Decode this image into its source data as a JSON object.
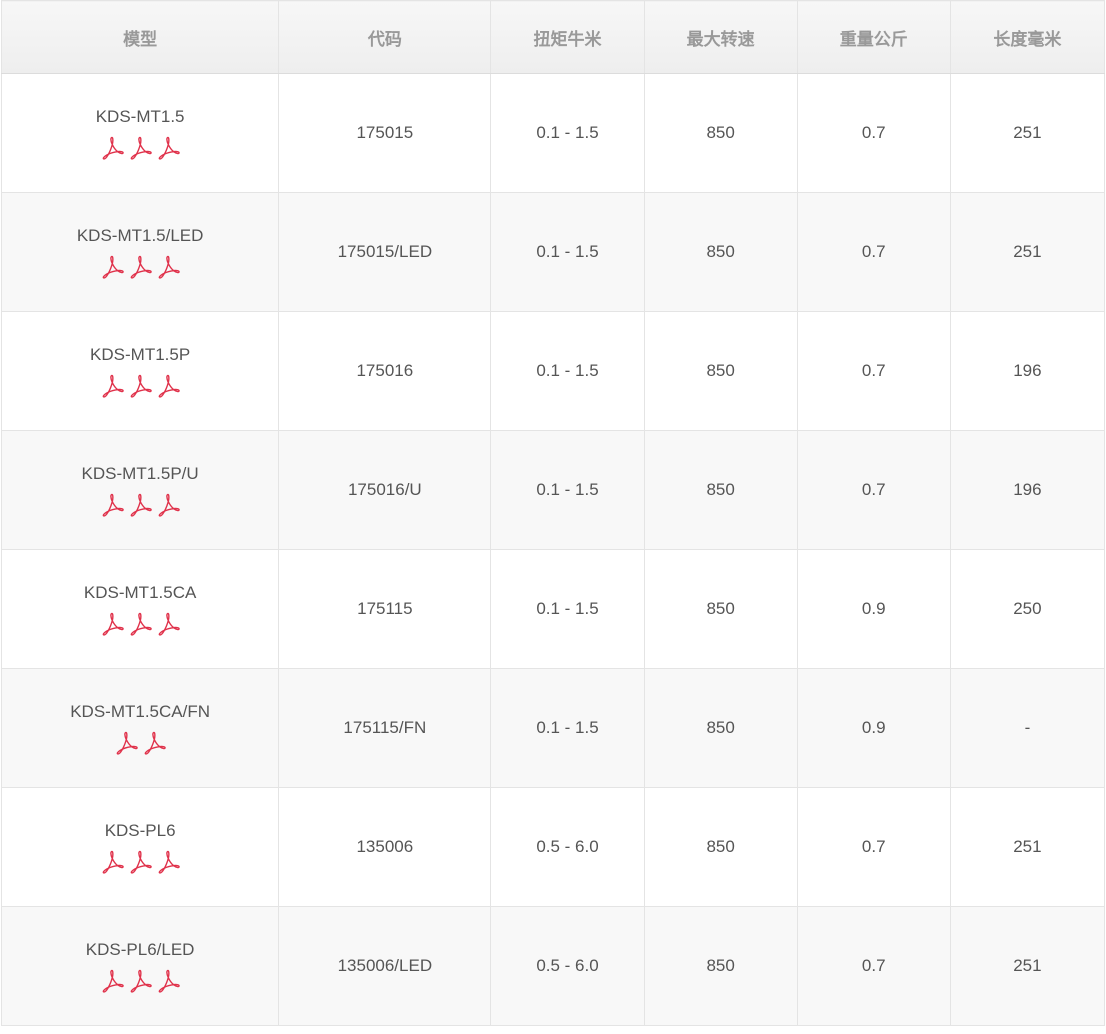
{
  "table": {
    "headers": [
      "模型",
      "代码",
      "扭矩牛米",
      "最大转速",
      "重量公斤",
      "长度毫米"
    ],
    "rows": [
      {
        "model": "KDS-MT1.5",
        "pdf_icons": 3,
        "code": "175015",
        "torque": "0.1 - 1.5",
        "max_speed": "850",
        "weight": "0.7",
        "length": "251"
      },
      {
        "model": "KDS-MT1.5/LED",
        "pdf_icons": 3,
        "code": "175015/LED",
        "torque": "0.1 - 1.5",
        "max_speed": "850",
        "weight": "0.7",
        "length": "251"
      },
      {
        "model": "KDS-MT1.5P",
        "pdf_icons": 3,
        "code": "175016",
        "torque": "0.1 - 1.5",
        "max_speed": "850",
        "weight": "0.7",
        "length": "196"
      },
      {
        "model": "KDS-MT1.5P/U",
        "pdf_icons": 3,
        "code": "175016/U",
        "torque": "0.1 - 1.5",
        "max_speed": "850",
        "weight": "0.7",
        "length": "196"
      },
      {
        "model": "KDS-MT1.5CA",
        "pdf_icons": 3,
        "code": "175115",
        "torque": "0.1 - 1.5",
        "max_speed": "850",
        "weight": "0.9",
        "length": "250"
      },
      {
        "model": "KDS-MT1.5CA/FN",
        "pdf_icons": 2,
        "code": "175115/FN",
        "torque": "0.1 - 1.5",
        "max_speed": "850",
        "weight": "0.9",
        "length": "-"
      },
      {
        "model": "KDS-PL6",
        "pdf_icons": 3,
        "code": "135006",
        "torque": "0.5 - 6.0",
        "max_speed": "850",
        "weight": "0.7",
        "length": "251"
      },
      {
        "model": "KDS-PL6/LED",
        "pdf_icons": 3,
        "code": "135006/LED",
        "torque": "0.5 - 6.0",
        "max_speed": "850",
        "weight": "0.7",
        "length": "251"
      }
    ]
  },
  "icons": {
    "pdf": "pdf-icon"
  },
  "colors": {
    "pdf_red": "#e0324b",
    "header_text": "#999999",
    "cell_text": "#555555",
    "border": "#e4e4e4",
    "row_alt": "#f8f8f8"
  }
}
